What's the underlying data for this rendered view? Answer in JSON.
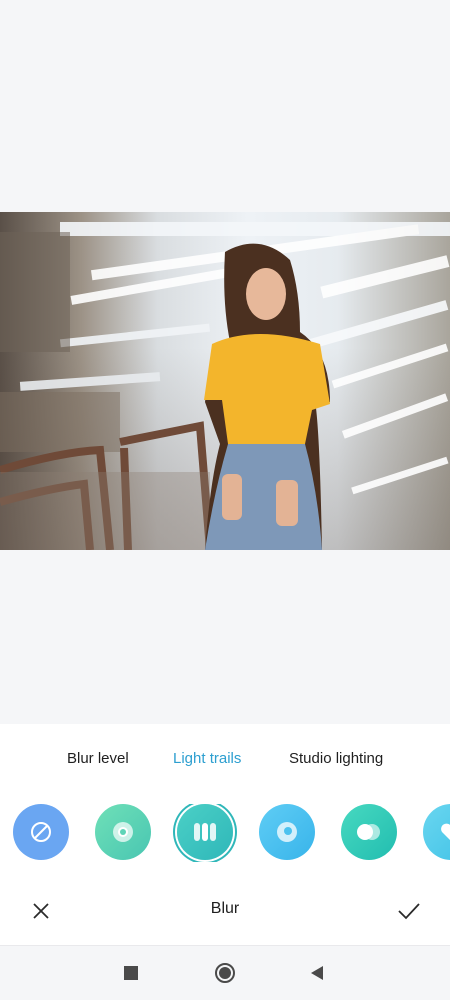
{
  "tabs": [
    {
      "label": "Blur level",
      "active": false
    },
    {
      "label": "Light trails",
      "active": true
    },
    {
      "label": "Studio lighting",
      "active": false
    }
  ],
  "effects": [
    {
      "icon": "no-effect-icon",
      "color": "#6aa6f2",
      "selected": false
    },
    {
      "icon": "ring-effect-icon",
      "color": "#5fd4b7",
      "selected": false
    },
    {
      "icon": "bars-effect-icon",
      "color": "#3cc4c2",
      "selected": true
    },
    {
      "icon": "swirl-effect-icon",
      "color": "#4bc2ef",
      "selected": false
    },
    {
      "icon": "double-circle-effect-icon",
      "color": "#34ccb9",
      "selected": false
    },
    {
      "icon": "heart-effect-icon",
      "color": "#56cdea",
      "selected": false
    }
  ],
  "bottom_bar": {
    "title": "Blur",
    "cancel_icon": "close-icon",
    "confirm_icon": "check-icon"
  },
  "nav": {
    "icons": [
      "recents-square-icon",
      "home-circle-icon",
      "back-triangle-icon"
    ]
  },
  "colors": {
    "accent": "#2d9fd0",
    "background": "#f5f6f8",
    "panel": "#ffffff",
    "text": "#1f1f1f"
  }
}
